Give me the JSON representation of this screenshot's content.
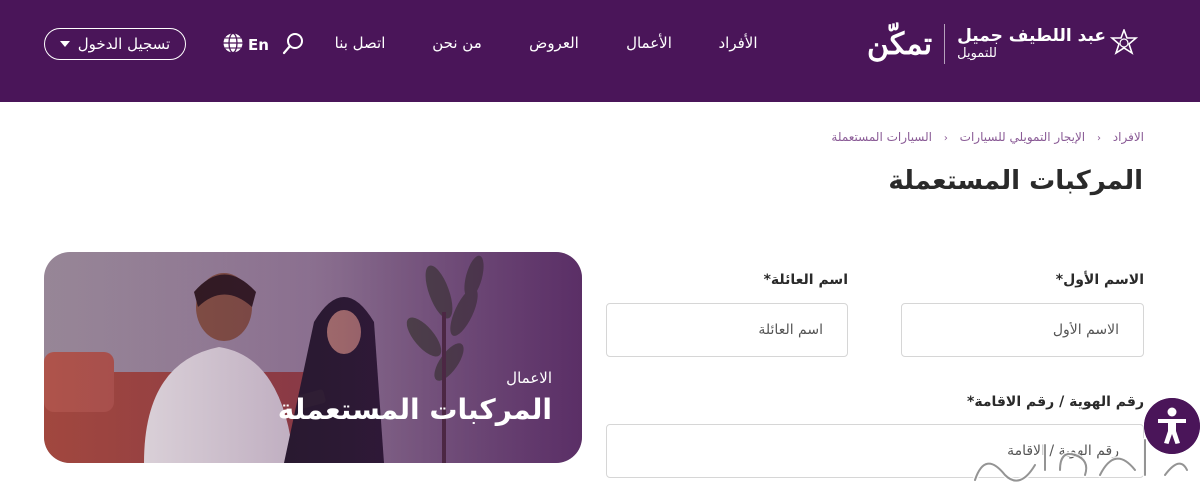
{
  "brand": {
    "company_line1": "عبد اللطيف جميل",
    "company_line2": "للتمويل",
    "product_name": "تمكّن"
  },
  "nav": {
    "items": [
      {
        "label": "الأفراد"
      },
      {
        "label": "الأعمال"
      },
      {
        "label": "العروض"
      },
      {
        "label": "من نحن"
      },
      {
        "label": "اتصل بنا"
      }
    ],
    "language_label": "En",
    "login_label": "تسجيل الدخول"
  },
  "breadcrumb": {
    "items": [
      "الافراد",
      "الإيجار التمويلي للسيارات",
      "السيارات المستعملة"
    ],
    "separator": "‹"
  },
  "page_title": "المركبات المستعملة",
  "hero": {
    "subtitle": "الاعمال",
    "title": "المركبات المستعملة"
  },
  "form": {
    "first_name": {
      "label": "الاسم الأول*",
      "placeholder": "الاسم الأول"
    },
    "last_name": {
      "label": "اسم العائلة*",
      "placeholder": "اسم العائلة"
    },
    "id_number": {
      "label": "رقم الهوية / رقم الاقامة*",
      "placeholder": "رقم الهوية / الاقامة"
    }
  },
  "watermark": {
    "text": "ترند"
  },
  "colors": {
    "header_bg": "#4a1559",
    "accent": "#8a5b96",
    "text_dark": "#2a2a2a"
  }
}
